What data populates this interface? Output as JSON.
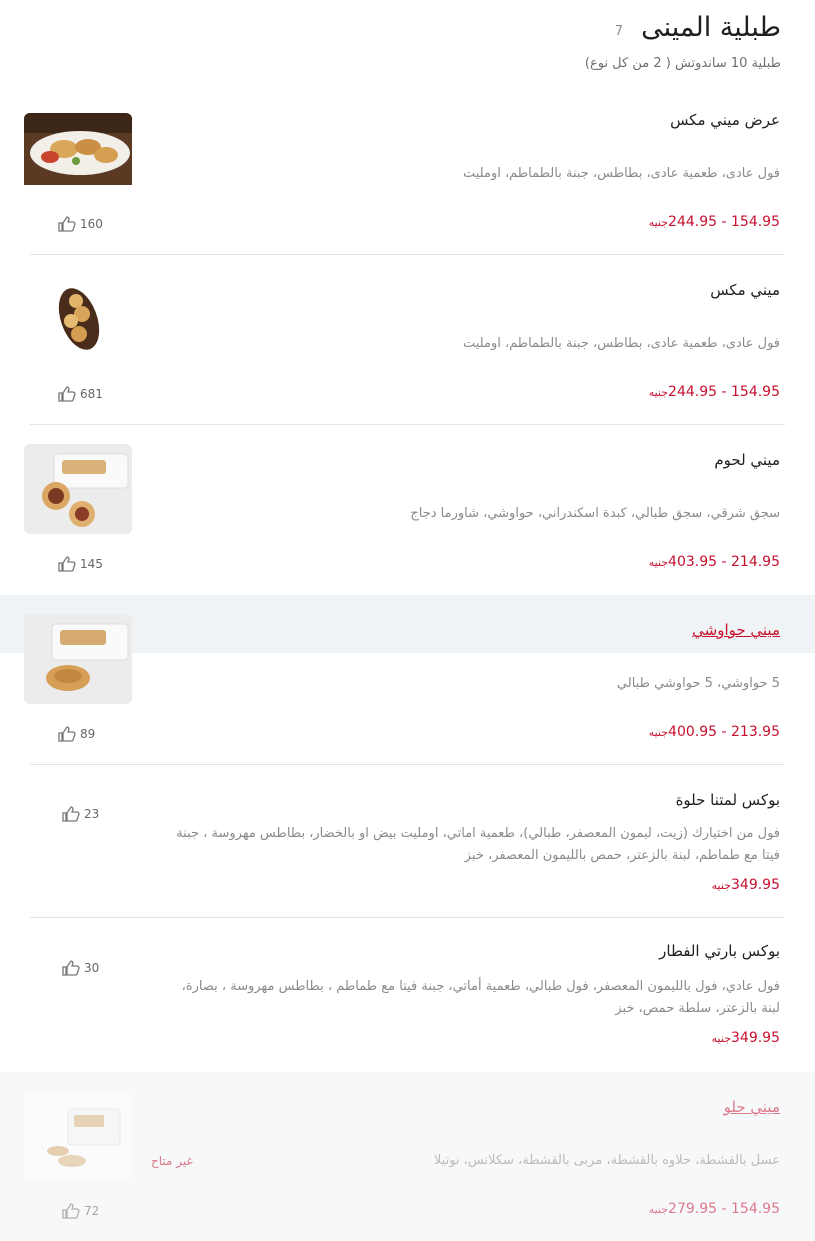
{
  "header": {
    "title": "طبلية المينى",
    "count": "7",
    "subtitle": "طبلية 10 ساندوتش ( 2 من كل نوع)"
  },
  "currency": "جنيه",
  "items": [
    {
      "name": "عرض ميني مكس",
      "desc": "فول عادى، طعمية عادى، بطاطس، جبنة بالطماطم، اومليت",
      "price": "154.95 - 244.95",
      "likes": "160"
    },
    {
      "name": "ميني مكس",
      "desc": "فول عادى، طعمية عادى، بطاطس، جبنة بالطماطم، اومليت",
      "price": "154.95 - 244.95",
      "likes": "681"
    },
    {
      "name": "ميني لحوم",
      "desc": "سجق شرقي، سجق طبالي، كبدة اسكندراني، حواوشي، شاورما دجاج",
      "price": "214.95 - 403.95",
      "likes": "145"
    },
    {
      "name": "ميني حواوشي",
      "desc": "5 حواوشي، 5 حواوشي طبالي",
      "price": "213.95 - 400.95",
      "likes": "89"
    },
    {
      "name": "بوكس لمتنا حلوة",
      "desc": "فول من اختيارك (زيت، ليمون المعصفر، طبالي)، طعمية اماتي، اومليت بيض او بالخضار، بطاطس مهروسة ، جبنة فيتا مع طماطم، لبنة بالزعتر، حمص بالليمون المعصفر، خبز",
      "price": "349.95",
      "likes": "23"
    },
    {
      "name": "بوكس بارتي الفطار",
      "desc": "فول عادي، فول بالليمون المعصفر، فول طبالي، طعمية أماتي، جبنة فيتا مع طماطم ، بطاطس مهروسة ، بصارة، لبنة بالزعتر، سلطة حمص، خبز",
      "price": "349.95",
      "likes": "30"
    },
    {
      "name": "ميني حلو",
      "desc": "عسل بالقشطة، حلاوه بالقشطة، مربى بالقشطة، سكلانس، نوتيلا",
      "price": "154.95 - 279.95",
      "likes": "72",
      "unavailable": "غير متاح"
    }
  ],
  "icons": {
    "like": "thumbs-up-icon"
  },
  "colors": {
    "accent": "#c8102e",
    "highlight_bg": "#eff3f6"
  }
}
